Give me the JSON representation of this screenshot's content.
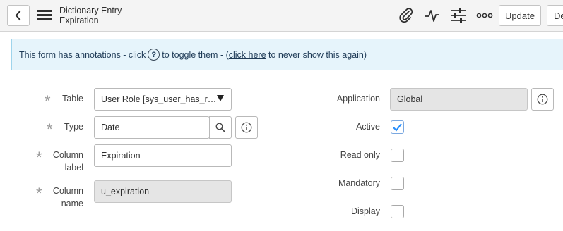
{
  "header": {
    "title": "Dictionary Entry",
    "subtitle": "Expiration",
    "update_label": "Update",
    "delete_label": "De",
    "icons": [
      "back-icon",
      "menu-icon",
      "attachment-icon",
      "activity-icon",
      "settings-icon",
      "more-icon"
    ]
  },
  "banner": {
    "text_before": "This form has annotations - click",
    "text_middle": "to toggle them - (",
    "link": "click here",
    "text_after": "to never show this again)",
    "help_glyph": "?"
  },
  "form": {
    "left": {
      "table": {
        "label": "Table",
        "value": "User Role [sys_user_has_r…"
      },
      "type": {
        "label": "Type",
        "value": "Date"
      },
      "column_label": {
        "label_line1": "Column",
        "label_line2": "label",
        "value": "Expiration"
      },
      "column_name": {
        "label_line1": "Column",
        "label_line2": "name",
        "value": "u_expiration"
      }
    },
    "right": {
      "application": {
        "label": "Application",
        "value": "Global"
      },
      "active": {
        "label": "Active",
        "checked": true
      },
      "read_only": {
        "label": "Read only",
        "checked": false
      },
      "mandatory": {
        "label": "Mandatory",
        "checked": false
      },
      "display": {
        "label": "Display",
        "checked": false
      }
    }
  },
  "colors": {
    "accent": "#278efc",
    "banner_bg": "#e6f4fb",
    "header_bg": "#f4f4f4"
  }
}
